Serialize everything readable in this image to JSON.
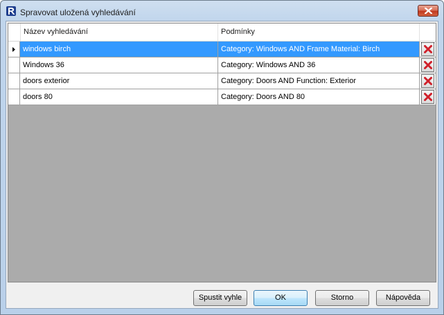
{
  "window": {
    "title": "Spravovat uložená vyhledávání",
    "colors": {
      "selection": "#3399ff",
      "delete_icon": "#d0202a"
    }
  },
  "grid": {
    "columns": [
      "Název vyhledávání",
      "Podmínky"
    ],
    "rows": [
      {
        "name": "windows birch",
        "conditions": "Category: Windows AND Frame Material: Birch",
        "selected": true
      },
      {
        "name": "Windows 36",
        "conditions": "Category: Windows AND 36",
        "selected": false
      },
      {
        "name": "doors exterior",
        "conditions": "Category: Doors AND Function: Exterior",
        "selected": false
      },
      {
        "name": "doors 80",
        "conditions": "Category: Doors AND 80",
        "selected": false
      }
    ],
    "current_row_icon": "row-pointer-icon",
    "delete_icon": "red-x-delete-icon"
  },
  "buttons": {
    "run": "Spustit vyhle",
    "ok": "OK",
    "cancel": "Storno",
    "help": "Nápověda"
  }
}
